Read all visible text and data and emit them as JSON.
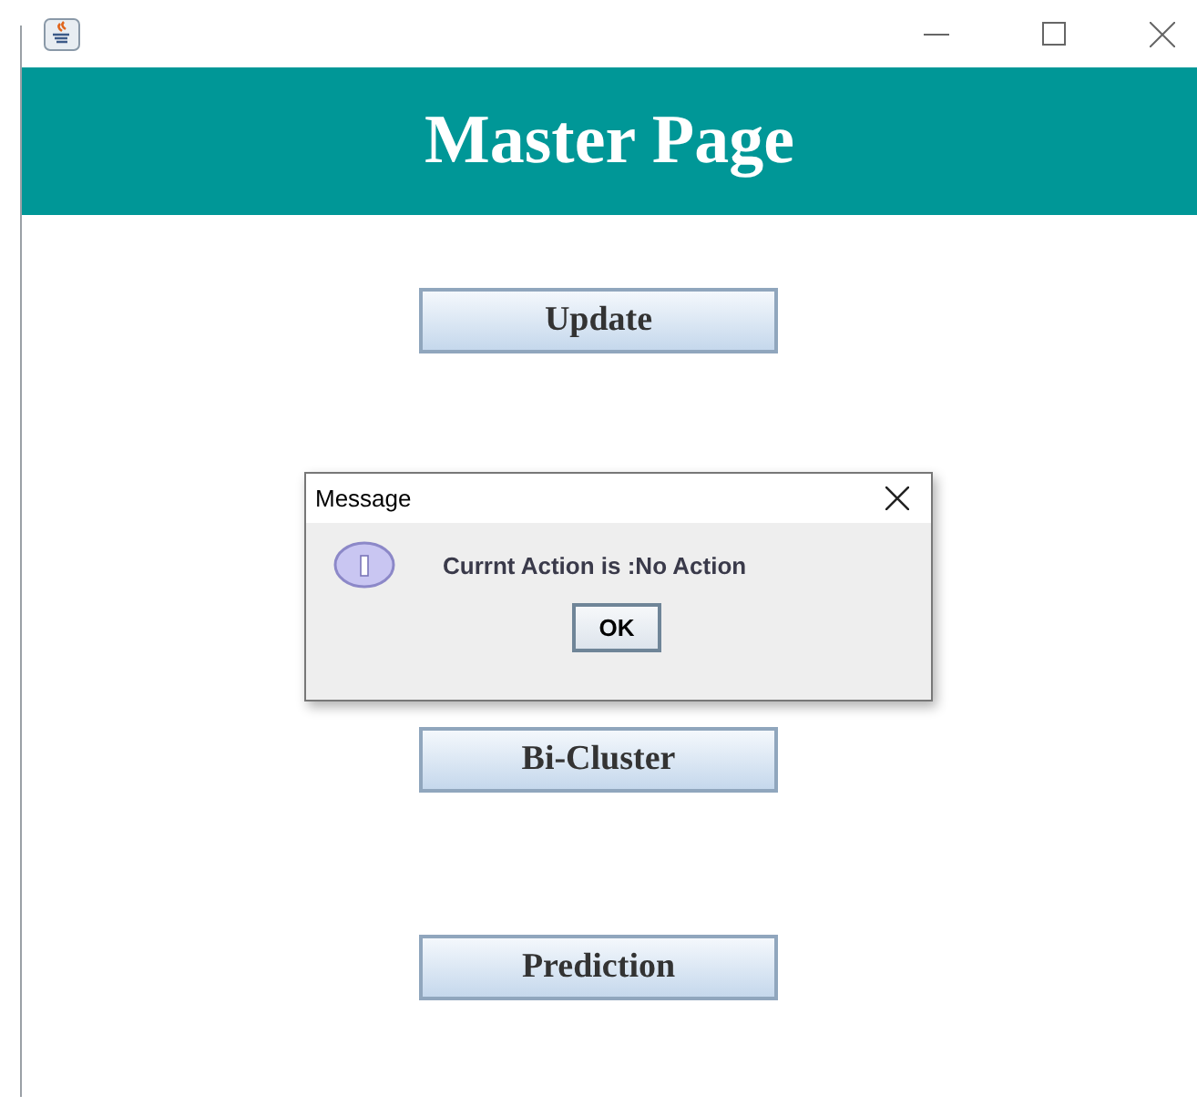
{
  "header": {
    "title": "Master Page"
  },
  "buttons": [
    {
      "label": "Update"
    },
    {
      "label": "Bi-Cluster"
    },
    {
      "label": "Prediction"
    }
  ],
  "dialog": {
    "title": "Message",
    "message": "Currnt Action is :No Action",
    "button": "OK"
  }
}
